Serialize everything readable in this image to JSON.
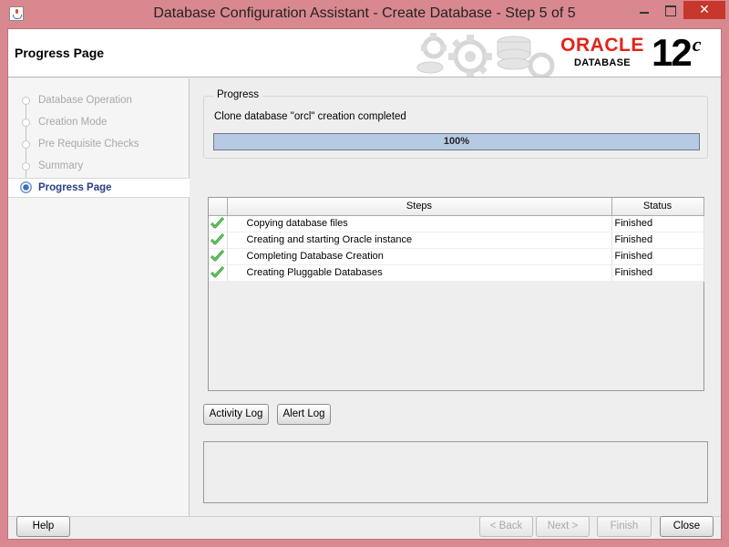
{
  "window": {
    "title": "Database Configuration Assistant - Create Database - Step 5 of 5",
    "minimize": "",
    "maximize": "",
    "close": "✕"
  },
  "header": {
    "page_title": "Progress Page",
    "brand": "ORACLE",
    "product": "DATABASE",
    "version": "12",
    "version_suffix": "c"
  },
  "nav": {
    "items": [
      {
        "label": "Database Operation",
        "active": false
      },
      {
        "label": "Creation Mode",
        "active": false
      },
      {
        "label": "Pre Requisite Checks",
        "active": false
      },
      {
        "label": "Summary",
        "active": false
      },
      {
        "label": "Progress Page",
        "active": true
      }
    ]
  },
  "progress": {
    "group_title": "Progress",
    "status": "Clone database \"orcl\" creation completed",
    "percent": 100,
    "percent_label": "100%"
  },
  "steps_table": {
    "columns": [
      "",
      "Steps",
      "Status"
    ],
    "rows": [
      {
        "step": "Copying database files",
        "status": "Finished"
      },
      {
        "step": "Creating and starting Oracle instance",
        "status": "Finished"
      },
      {
        "step": "Completing Database Creation",
        "status": "Finished"
      },
      {
        "step": "Creating Pluggable Databases",
        "status": "Finished"
      }
    ]
  },
  "logs": {
    "activity_log": "Activity Log",
    "alert_log": "Alert Log"
  },
  "footer": {
    "help": "Help",
    "back": "< Back",
    "next": "Next >",
    "finish": "Finish",
    "close": "Close"
  },
  "colors": {
    "frame": "#d98890",
    "close_red": "#c7372c",
    "oracle_red": "#e2231a",
    "progress_fill": "#b6cae4",
    "nav_active": "#2a3e82",
    "check_green": "#2f9a2f"
  }
}
